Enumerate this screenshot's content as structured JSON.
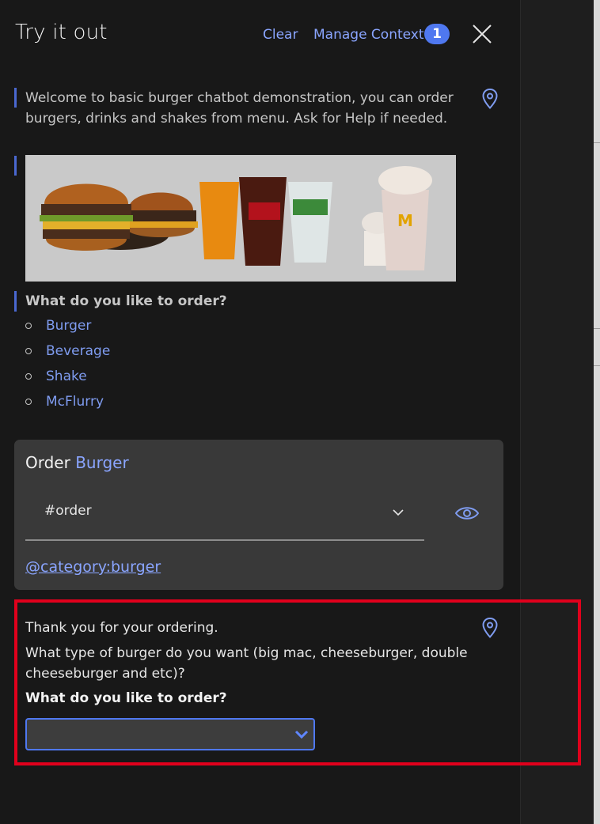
{
  "header": {
    "title": "Try it out",
    "clear_label": "Clear",
    "manage_label": "Manage Context",
    "context_count": "1"
  },
  "welcome": {
    "line1": "Welcome to basic burger chatbot demonstration, you can order",
    "line2": "burgers, drinks and shakes from menu. Ask for Help if needed."
  },
  "banner": {
    "logo_letter": "M"
  },
  "menu": {
    "question": "What do you like to order?",
    "options": [
      "Burger",
      "Beverage",
      "Shake",
      "McFlurry"
    ]
  },
  "intent_card": {
    "title_prefix": "Order",
    "title_accent": "Burger",
    "intent_value": "#order",
    "entity_link": "@category:burger"
  },
  "reply": {
    "line1": "Thank you for your ordering.",
    "line2": "What type of burger do you want (big mac, cheeseburger, double",
    "line3": "cheeseburger and etc)?",
    "question": "What do you like to order?",
    "select_value": ""
  },
  "colors": {
    "accent": "#8aa5ff",
    "badge": "#4f78f0",
    "highlight": "#e0001c"
  }
}
